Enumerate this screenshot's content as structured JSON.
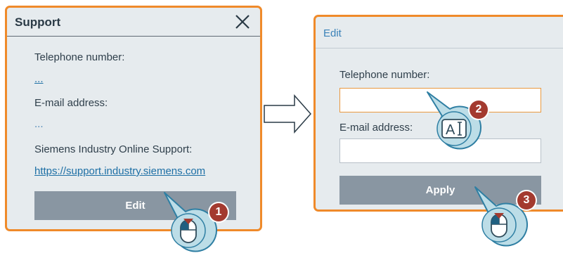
{
  "support_dialog": {
    "title": "Support",
    "telephone_label": "Telephone number:",
    "telephone_value": "...",
    "email_label": "E-mail address:",
    "email_value": "...",
    "online_support_label": "Siemens Industry Online Support:",
    "online_support_link": "https://support.industry.siemens.com",
    "edit_button": "Edit"
  },
  "edit_dialog": {
    "title": "Edit",
    "telephone_label": "Telephone number:",
    "telephone_input_value": "",
    "email_label": "E-mail address:",
    "email_input_value": "",
    "apply_button": "Apply"
  },
  "steps": [
    "1",
    "2",
    "3"
  ],
  "icons": [
    "close-icon",
    "arrow-right-icon",
    "mouse-click-icon",
    "text-input-icon"
  ],
  "colors": {
    "dialog_border": "#ef8a2a",
    "dialog_bg": "#e6ebee",
    "button_bg": "#8996a2",
    "link": "#1d6fa5",
    "step_badge": "#a33a2f",
    "callout_fill": "#bcdde7",
    "callout_stroke": "#2f7fa3"
  }
}
